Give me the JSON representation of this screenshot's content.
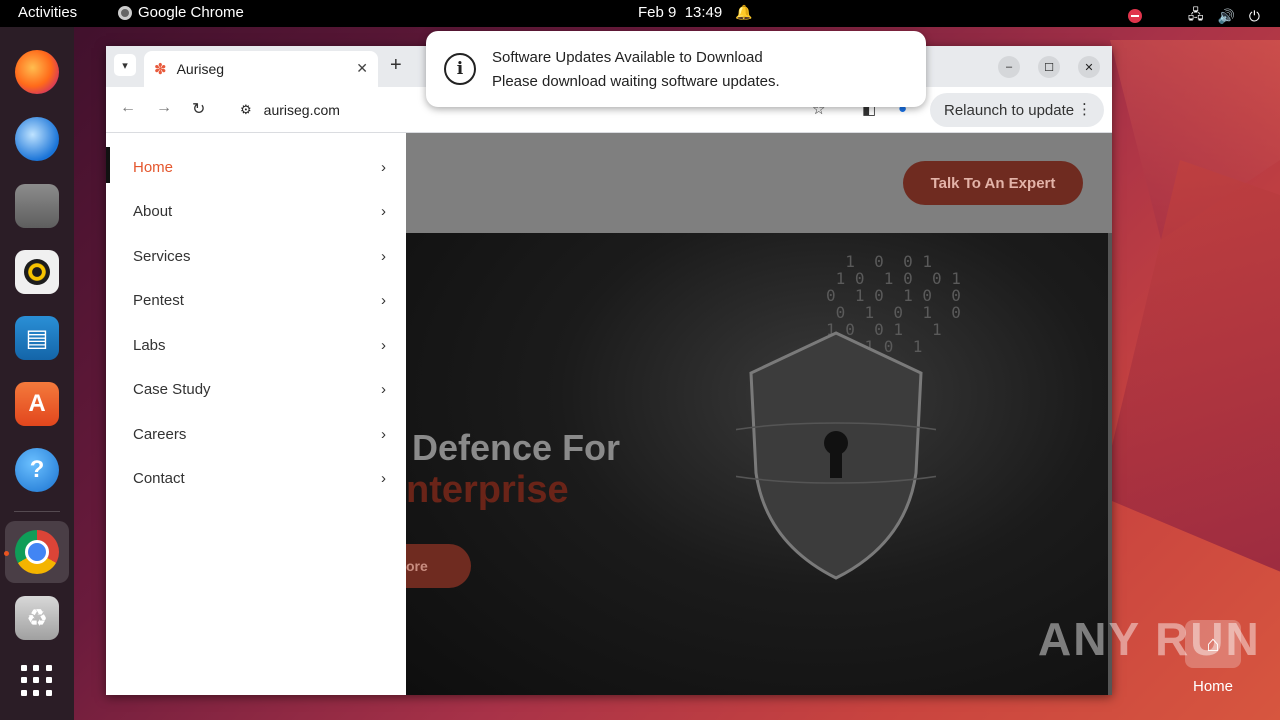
{
  "topbar": {
    "activities": "Activities",
    "app_name": "Google Chrome",
    "date": "Feb 9",
    "time": "13:49"
  },
  "dock": {
    "items": [
      "firefox-icon",
      "thunderbird-icon",
      "files-icon",
      "rhythmbox-icon",
      "writer-icon",
      "app-center-icon",
      "help-icon",
      "chrome-icon",
      "trash-icon",
      "app-grid-icon"
    ]
  },
  "browser": {
    "tab_title": "Auriseg",
    "url": "auriseg.com",
    "relaunch_label": "Relaunch to update"
  },
  "notification": {
    "title": "Software Updates Available to Download",
    "body": "Please download waiting software updates."
  },
  "page": {
    "cta_label": "Talk To An Expert",
    "hero_line1": "Defence For",
    "hero_line2": "nterprise",
    "hero_button": "ore"
  },
  "menu": {
    "items": [
      {
        "label": "Home",
        "active": true
      },
      {
        "label": "About"
      },
      {
        "label": "Services"
      },
      {
        "label": "Pentest"
      },
      {
        "label": "Labs"
      },
      {
        "label": "Case Study"
      },
      {
        "label": "Careers"
      },
      {
        "label": "Contact"
      }
    ]
  },
  "desktop": {
    "watermark": "ANY RUN",
    "home_label": "Home"
  },
  "colors": {
    "accent": "#e4572e",
    "cta_bg": "#6f2b20",
    "ubuntu_orange": "#e95420"
  }
}
